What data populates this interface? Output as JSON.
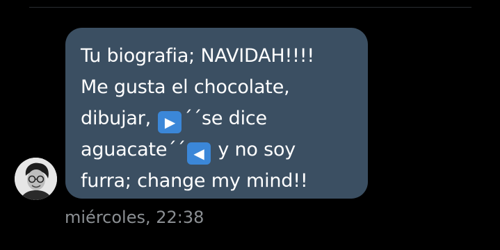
{
  "message": {
    "line1": "Tu biografia; NAVIDAH!!!!",
    "line2": "Me gusta el chocolate,",
    "line3_prefix": "dibujar, ",
    "emoji_play": "▶",
    "line3_suffix": "´´se dice",
    "line4_prefix": "aguacate´´",
    "emoji_reverse": "◀",
    "line4_suffix": " y no soy",
    "line5": "furra; change my mind!!",
    "timestamp": "miércoles, 22:38"
  },
  "colors": {
    "background": "#000000",
    "bubble": "#3b4f62",
    "emoji_button": "#3b87d8",
    "timestamp": "#8b8f93"
  },
  "icons": {
    "emoji_play": "play-button-emoji",
    "emoji_reverse": "reverse-button-emoji",
    "avatar": "user-avatar"
  }
}
